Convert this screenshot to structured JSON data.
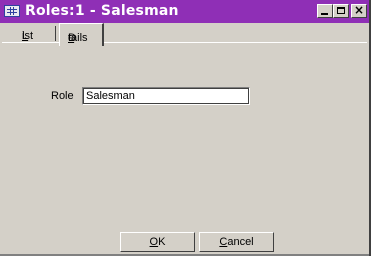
{
  "window": {
    "title": "Roles:1 - Salesman",
    "icons": {
      "app": "table-icon",
      "minimize": "minimize-icon",
      "maximize": "maximize-icon",
      "close": "close-icon"
    },
    "colors": {
      "titlebar": "#8f2fb6",
      "face": "#d4d0c8"
    }
  },
  "tabs": [
    {
      "label_underlined": "L",
      "label_rest": "ist",
      "active": false
    },
    {
      "label_pre": "D",
      "label_underlined": "e",
      "label_rest": "tails",
      "active": true
    }
  ],
  "form": {
    "role_label": "Role",
    "role_value": "Salesman"
  },
  "buttons": {
    "ok": {
      "underlined": "O",
      "rest": "K"
    },
    "cancel": {
      "underlined": "C",
      "rest": "ancel"
    }
  }
}
